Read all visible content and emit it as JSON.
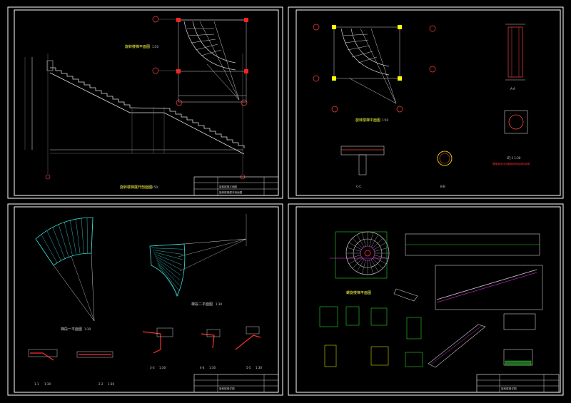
{
  "sheets": [
    {
      "id": "sheet1",
      "titles": {
        "plan": "旋转楼梯平面图",
        "plan_scale": "1:50",
        "elevation": "旋转楼梯展开剖面图",
        "elevation_scale": "1:50"
      },
      "titleblock": [
        "旋转楼梯平面图",
        "旋转楼梯展开剖面图"
      ]
    },
    {
      "id": "sheet2",
      "titles": {
        "plan": "旋转楼梯平面图",
        "plan_scale": "1:50",
        "section_c": "C-C",
        "section_b": "B-B",
        "section_a": "A-A",
        "ltj": "LTJ-1 1:30",
        "note": "基础做法详见图纸说明及结构说明"
      }
    },
    {
      "id": "sheet3",
      "titles": {
        "plan1": "梯段一平面图",
        "plan1_scale": "1:30",
        "plan2": "梯段二平面图",
        "plan2_scale": "1:30",
        "s11": "1-1",
        "s11_scale": "1:30",
        "s22": "2-2",
        "s22_scale": "1:30",
        "s33": "3-3",
        "s33_scale": "1:30",
        "s44": "4-4",
        "s44_scale": "1:30",
        "s55": "5-5",
        "s55_scale": "1:30"
      },
      "titleblock": [
        "旋转楼梯详图"
      ]
    },
    {
      "id": "sheet4",
      "titles": {
        "plan": "螺旋楼梯平面图"
      },
      "titleblock": [
        "旋转楼梯详图"
      ]
    }
  ],
  "colors": {
    "background": "#000000",
    "frame": "#ffffff",
    "lines": "#d0d0d0",
    "cyan": "#40e0e0",
    "red": "#ff2020",
    "yellow": "#ffff00",
    "green": "#30ff30",
    "magenta": "#ff40ff"
  }
}
